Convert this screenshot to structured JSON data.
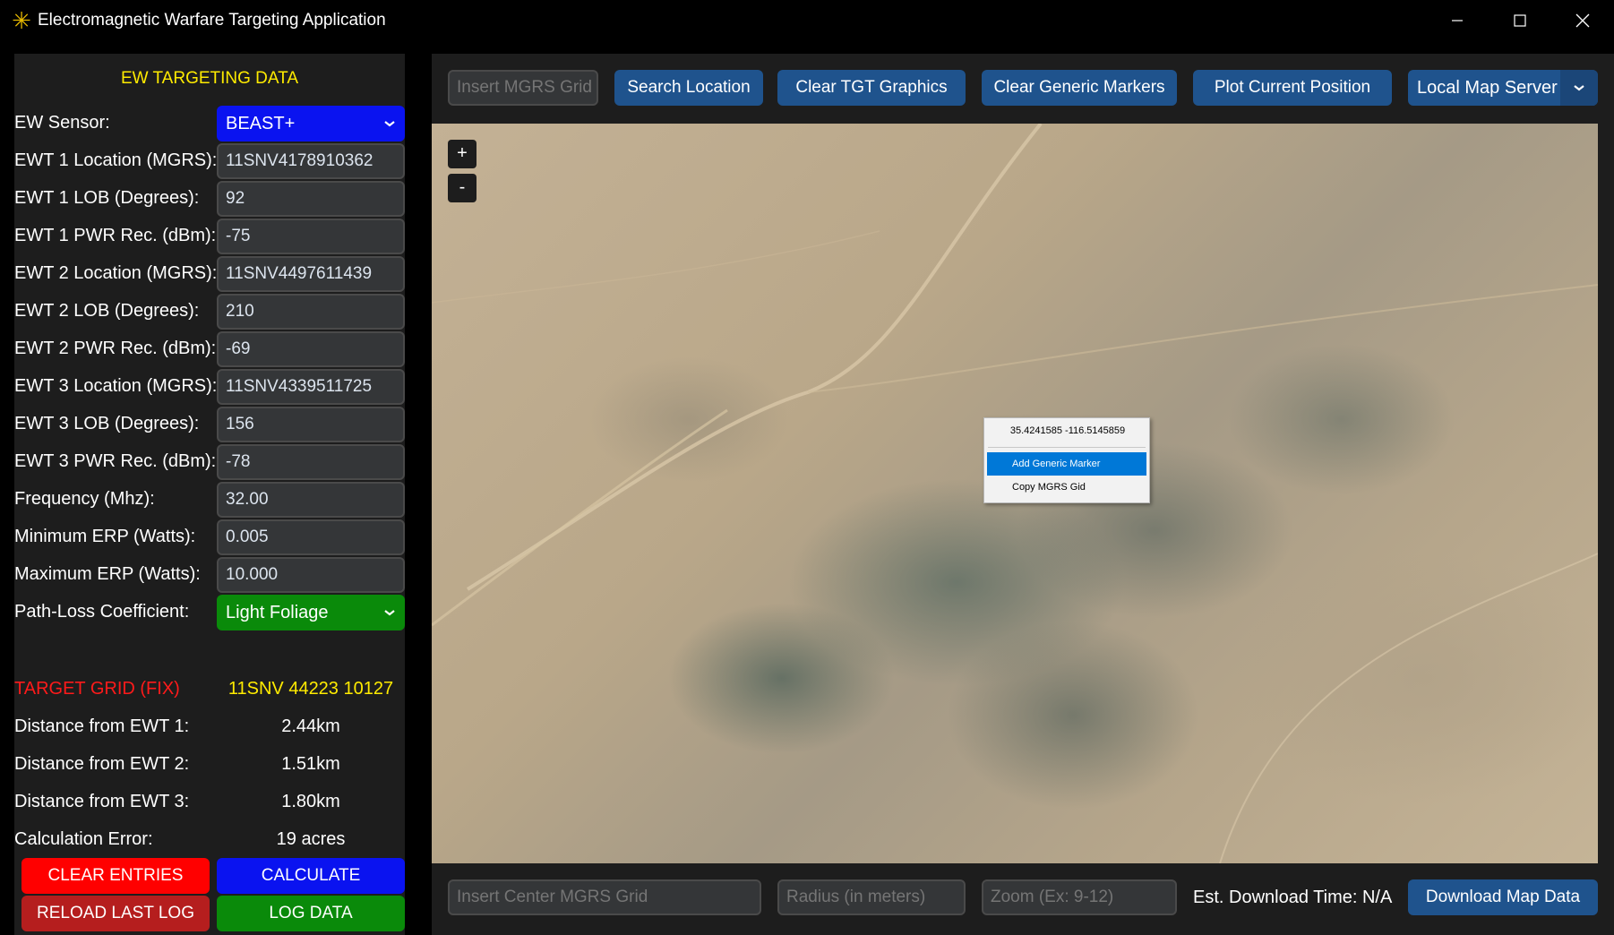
{
  "window": {
    "title": "Electromagnetic Warfare Targeting Application",
    "app_icon": "asterisk-icon",
    "icon_color": "#e6b800"
  },
  "left_panel": {
    "title": "EW TARGETING DATA",
    "fields": {
      "ew_sensor": {
        "label": "EW Sensor:",
        "value": "BEAST+"
      },
      "ewt1_location": {
        "label": "EWT 1 Location (MGRS):",
        "value": "11SNV4178910362"
      },
      "ewt1_lob": {
        "label": "EWT 1 LOB (Degrees):",
        "value": "92"
      },
      "ewt1_pwr": {
        "label": "EWT 1 PWR Rec. (dBm):",
        "value": "-75"
      },
      "ewt2_location": {
        "label": "EWT 2 Location (MGRS):",
        "value": "11SNV4497611439"
      },
      "ewt2_lob": {
        "label": "EWT 2 LOB (Degrees):",
        "value": "210"
      },
      "ewt2_pwr": {
        "label": "EWT 2 PWR Rec. (dBm):",
        "value": "-69"
      },
      "ewt3_location": {
        "label": "EWT 3 Location (MGRS):",
        "value": "11SNV4339511725"
      },
      "ewt3_lob": {
        "label": "EWT 3 LOB (Degrees):",
        "value": "156"
      },
      "ewt3_pwr": {
        "label": "EWT 3 PWR Rec. (dBm):",
        "value": "-78"
      },
      "frequency": {
        "label": "Frequency (Mhz):",
        "value": "32.00"
      },
      "min_erp": {
        "label": "Minimum ERP (Watts):",
        "value": "0.005"
      },
      "max_erp": {
        "label": "Maximum ERP (Watts):",
        "value": "10.000"
      },
      "path_loss": {
        "label": "Path-Loss Coefficient:",
        "value": "Light Foliage"
      }
    },
    "results": {
      "target_grid": {
        "label": "TARGET GRID (FIX)",
        "value": "11SNV 44223 10127"
      },
      "dist1": {
        "label": "Distance from EWT 1:",
        "value": "2.44km"
      },
      "dist2": {
        "label": "Distance from EWT 2:",
        "value": "1.51km"
      },
      "dist3": {
        "label": "Distance from EWT 3:",
        "value": "1.80km"
      },
      "calc_error": {
        "label": "Calculation Error:",
        "value": "19 acres"
      }
    },
    "buttons": {
      "clear_entries": "CLEAR ENTRIES",
      "calculate": "CALCULATE",
      "reload_last_log": "RELOAD LAST LOG",
      "log_data": "LOG DATA"
    },
    "colors": {
      "title": "#ffeb00",
      "target_label": "#ff1a1a",
      "target_value": "#ffeb00",
      "sensor_select": "#0a13f0",
      "pathloss_select": "#0a8a0a",
      "clear_btn": "#ff0000",
      "reload_btn": "#b51e1e",
      "calculate_btn": "#0a13f0",
      "log_btn": "#0a8a0a"
    }
  },
  "toolbar": {
    "mgrs_placeholder": "Insert MGRS Grid",
    "search_location": "Search Location",
    "clear_tgt_graphics": "Clear TGT Graphics",
    "clear_generic_markers": "Clear Generic Markers",
    "plot_current_position": "Plot Current Position",
    "map_server": "Local Map Server",
    "accent": "#1f538d"
  },
  "map": {
    "zoom_in": "+",
    "zoom_out": "-",
    "context_menu": {
      "coords": "35.4241585 -116.5145859",
      "items": [
        "Add Generic Marker",
        "Copy MGRS Gid"
      ],
      "active_item": "Add Generic Marker"
    }
  },
  "download_bar": {
    "center_placeholder": "Insert Center MGRS Grid",
    "radius_placeholder": "Radius (in meters)",
    "zoom_placeholder": "Zoom (Ex: 9-12)",
    "est_download": "Est. Download Time: N/A",
    "download_button": "Download Map Data"
  }
}
